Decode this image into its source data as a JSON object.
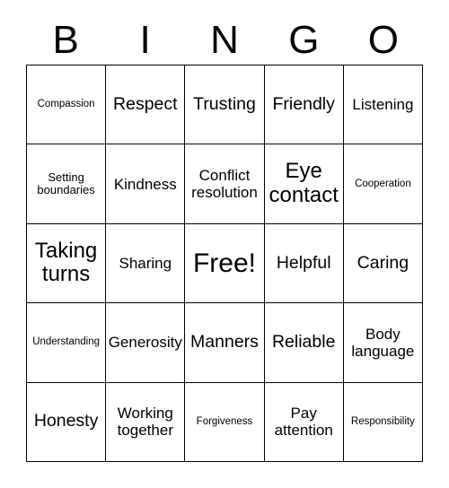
{
  "header": {
    "letters": [
      "B",
      "I",
      "N",
      "G",
      "O"
    ]
  },
  "grid": {
    "rows": [
      [
        {
          "text": "Compassion",
          "size": "xs"
        },
        {
          "text": "Respect",
          "size": "lg"
        },
        {
          "text": "Trusting",
          "size": "lg"
        },
        {
          "text": "Friendly",
          "size": "lg"
        },
        {
          "text": "Listening",
          "size": "md"
        }
      ],
      [
        {
          "text": "Setting boundaries",
          "size": "sm"
        },
        {
          "text": "Kindness",
          "size": "md"
        },
        {
          "text": "Conflict resolution",
          "size": "md"
        },
        {
          "text": "Eye contact",
          "size": "xl"
        },
        {
          "text": "Cooperation",
          "size": "xs"
        }
      ],
      [
        {
          "text": "Taking turns",
          "size": "xl"
        },
        {
          "text": "Sharing",
          "size": "md"
        },
        {
          "text": "Free!",
          "size": "xxl"
        },
        {
          "text": "Helpful",
          "size": "lg"
        },
        {
          "text": "Caring",
          "size": "lg"
        }
      ],
      [
        {
          "text": "Understanding",
          "size": "xs"
        },
        {
          "text": "Generosity",
          "size": "md"
        },
        {
          "text": "Manners",
          "size": "lg"
        },
        {
          "text": "Reliable",
          "size": "lg"
        },
        {
          "text": "Body language",
          "size": "md"
        }
      ],
      [
        {
          "text": "Honesty",
          "size": "lg"
        },
        {
          "text": "Working together",
          "size": "md"
        },
        {
          "text": "Forgiveness",
          "size": "xs"
        },
        {
          "text": "Pay attention",
          "size": "md"
        },
        {
          "text": "Responsibility",
          "size": "xs"
        }
      ]
    ]
  },
  "colors": {
    "text": "#000000",
    "border": "#000000",
    "background": "#ffffff"
  }
}
